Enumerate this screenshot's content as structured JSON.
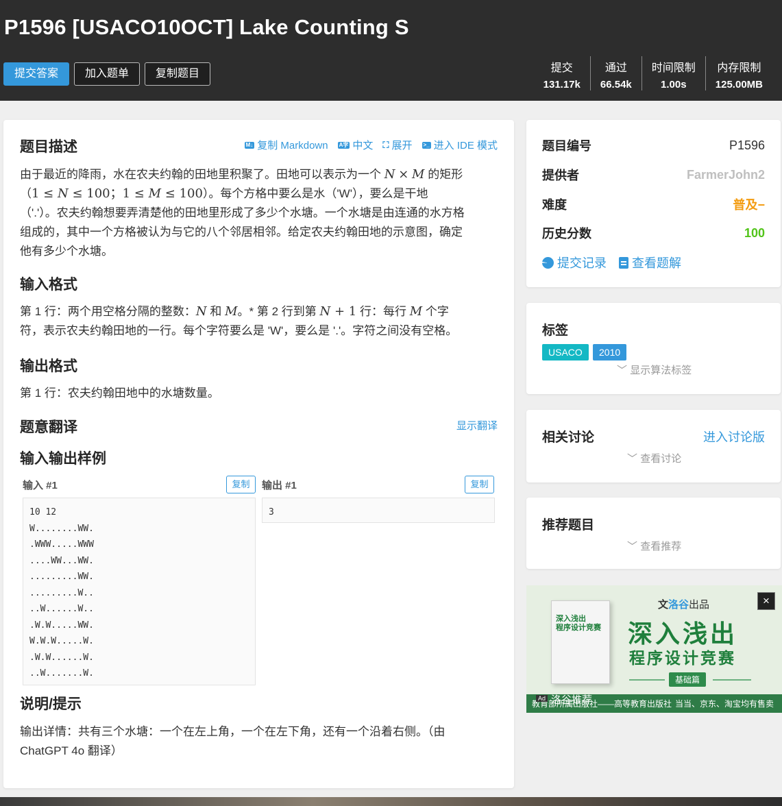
{
  "header": {
    "title": "P1596 [USACO10OCT] Lake Counting S",
    "buttons": {
      "submit": "提交答案",
      "add_list": "加入题单",
      "copy": "复制题目"
    },
    "stats": [
      {
        "label": "提交",
        "value": "131.17k"
      },
      {
        "label": "通过",
        "value": "66.54k"
      },
      {
        "label": "时间限制",
        "value": "1.00s"
      },
      {
        "label": "内存限制",
        "value": "125.00MB"
      }
    ]
  },
  "toolbar": {
    "copy_markdown": "复制 Markdown",
    "chinese": "中文",
    "expand": "展开",
    "ide": "进入 IDE 模式"
  },
  "problem": {
    "desc_title": "题目描述",
    "desc_l1a": "由于最近的降雨，水在农夫约翰的田地里积聚了。田地可以表示为一个",
    "desc_l1b": "的矩形",
    "desc_N": "N",
    "desc_times": "×",
    "desc_M": "M",
    "desc_l2a": "（",
    "desc_c1": "1 ≤ ",
    "desc_c2": " ≤ 100",
    "desc_c3": "；1 ≤ ",
    "desc_c4": " ≤ 100",
    "desc_l2b": "）。每个方格中要么是水（'W'），要么是干地",
    "desc_l3": "（'.'）。农夫约翰想要弄清楚他的田地里形成了多少个水塘。一个水塘是由连通的水方格",
    "desc_l4": "组成的，其中一个方格被认为与它的八个邻居相邻。给定农夫约翰田地的示意图，确定",
    "desc_l5": "他有多少个水塘。",
    "input_title": "输入格式",
    "input_l1a": "第 1 行：两个用空格分隔的整数：",
    "input_l1b": " 和 ",
    "input_l1c": "。* 第 2 行到第 ",
    "input_l1d": " + 1",
    "input_l1e": " 行：每行 ",
    "input_l1f": " 个字",
    "input_l2": "符，表示农夫约翰田地的一行。每个字符要么是 'W'，要么是 '.'。字符之间没有空格。",
    "output_title": "输出格式",
    "output_l1": "第 1 行：农夫约翰田地中的水塘数量。",
    "trans_title": "题意翻译",
    "show_trans": "显示翻译",
    "sample_title": "输入输出样例",
    "input_label": "输入 #1",
    "output_label": "输出 #1",
    "copy_btn": "复制",
    "sample_input": "10 12\nW........WW.\n.WWW.....WWW\n....WW...WW.\n.........WW.\n.........W..\n..W......W..\n.W.W.....WW.\nW.W.W.....W.\n.W.W......W.\n..W.......W.",
    "sample_output": "3",
    "hint_title": "说明/提示",
    "hint_l1": "输出详情：共有三个水塘：一个在左上角，一个在左下角，还有一个沿着右侧。（由",
    "hint_l2": "ChatGPT 4o 翻译）"
  },
  "info": {
    "pid_label": "题目编号",
    "pid": "P1596",
    "provider_label": "提供者",
    "provider": "FarmerJohn2",
    "diff_label": "难度",
    "diff": "普及−",
    "score_label": "历史分数",
    "score": "100",
    "records": "提交记录",
    "solutions": "查看题解"
  },
  "tags": {
    "title": "标签",
    "items": [
      "USACO",
      "2010"
    ],
    "show_algo": "显示算法标签"
  },
  "discuss": {
    "title": "相关讨论",
    "enter": "进入讨论版",
    "view": "查看讨论"
  },
  "recommend": {
    "title": "推荐题目",
    "view": "查看推荐"
  },
  "ad": {
    "logo_a": "洛谷",
    "logo_b": "出品",
    "big1": "深入浅出",
    "big2": "程序设计竞赛",
    "pill": "基础篇",
    "book_text": "深入浅出\n程序设计竞赛",
    "bottom_left": "教育部所属出版社——高等教育出版社",
    "bottom_right": "当当、京东、淘宝均有售卖",
    "tag": "Ad",
    "rec": "洛谷推荐",
    "close": "×"
  },
  "colors": {
    "accent": "#3498db",
    "orange": "#f39c11",
    "green": "#52c41a",
    "teal": "#14b8c4",
    "header": "#2d2d2d"
  }
}
